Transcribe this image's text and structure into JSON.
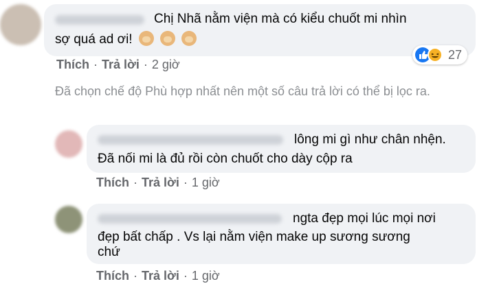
{
  "comments": [
    {
      "text_lines": [
        "Chị Nhã nằm viện mà có kiểu chuốt mi nhìn",
        "sợ quá ad ơi!"
      ],
      "emoji_icons": [
        "monkey-face-icon",
        "monkey-face-icon",
        "monkey-face-icon"
      ],
      "reaction_count": "27",
      "reaction_icons": [
        "like-icon",
        "haha-icon"
      ],
      "actions": {
        "like": "Thích",
        "reply": "Trả lời",
        "time": "2 giờ"
      }
    }
  ],
  "filter_notice": "Đã chọn chế độ Phù hợp nhất nên một số câu trả lời có thể bị lọc ra.",
  "replies": [
    {
      "text_lines": [
        "lông mi gì như chân nhện.",
        "Đã nối mi là đủ rồi còn chuốt cho dày cộp ra"
      ],
      "actions": {
        "like": "Thích",
        "reply": "Trả lời",
        "time": "1 giờ"
      }
    },
    {
      "text_lines": [
        "ngta đẹp mọi lúc mọi nơi",
        "đẹp bất chấp . Vs lại nằm viện make up sương sương",
        "chứ"
      ],
      "actions": {
        "like": "Thích",
        "reply": "Trả lời",
        "time": "1 giờ"
      }
    }
  ],
  "colors": {
    "bubble": "#f0f2f5",
    "action_text": "#65676b",
    "like_blue": "#1877f2",
    "haha_yellow": "#f7b125"
  }
}
